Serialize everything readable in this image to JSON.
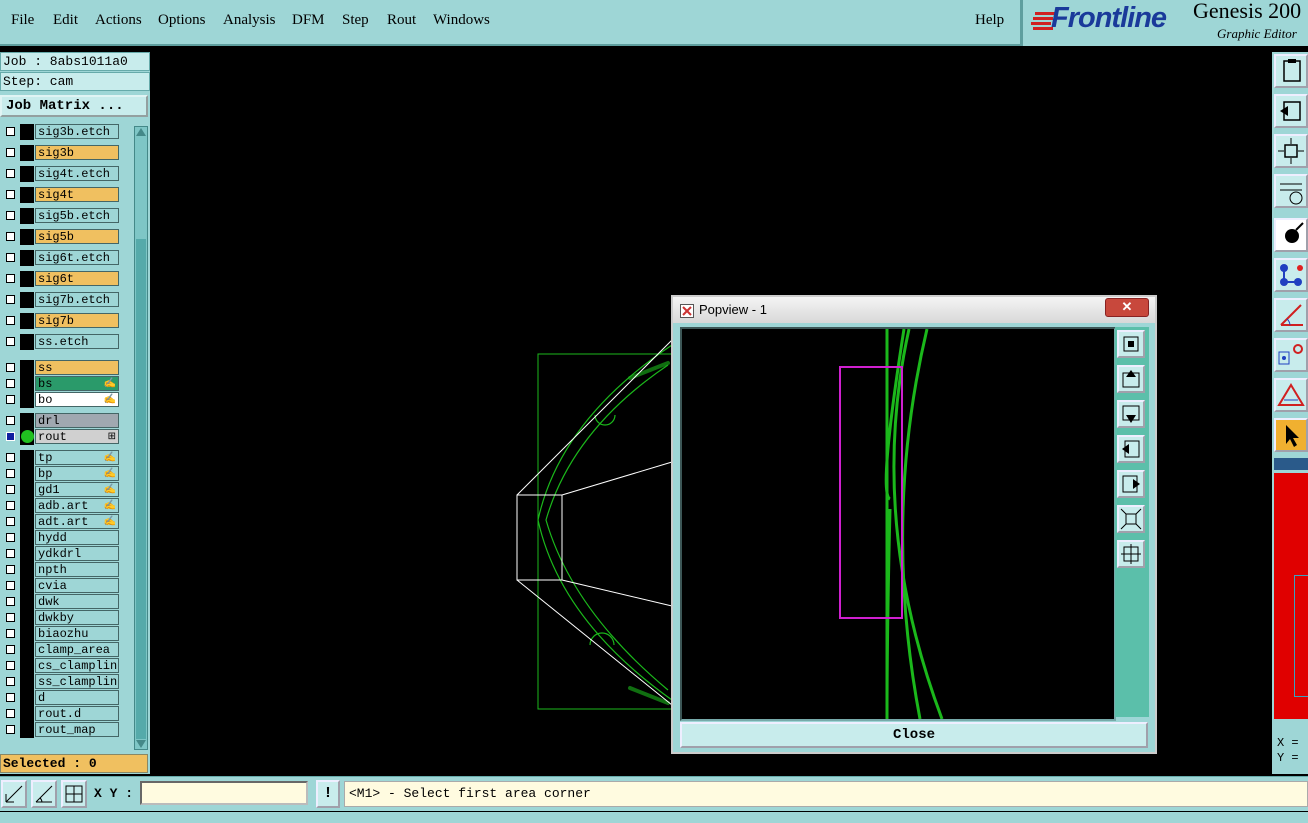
{
  "menubar": {
    "items": [
      "File",
      "Edit",
      "Actions",
      "Options",
      "Analysis",
      "DFM",
      "Step",
      "Rout",
      "Windows"
    ],
    "help": "Help"
  },
  "brand": {
    "logo": "Frontline",
    "title": "Genesis 200",
    "subtitle": "Graphic Editor"
  },
  "job": {
    "job_line": "Job : 8abs1011a0",
    "step_line": "Step: cam",
    "matrix_button": "Job Matrix ...",
    "selected": "Selected : 0"
  },
  "layers": [
    {
      "name": "sig3b.etch",
      "color": "#9ed6d6",
      "mark": ""
    },
    {
      "name": "sig3b",
      "color": "#f0c060",
      "mark": ""
    },
    {
      "name": "sig4t.etch",
      "color": "#9ed6d6",
      "mark": ""
    },
    {
      "name": "sig4t",
      "color": "#f0c060",
      "mark": ""
    },
    {
      "name": "sig5b.etch",
      "color": "#9ed6d6",
      "mark": ""
    },
    {
      "name": "sig5b",
      "color": "#f0c060",
      "mark": ""
    },
    {
      "name": "sig6t.etch",
      "color": "#9ed6d6",
      "mark": ""
    },
    {
      "name": "sig6t",
      "color": "#f0c060",
      "mark": ""
    },
    {
      "name": "sig7b.etch",
      "color": "#9ed6d6",
      "mark": ""
    },
    {
      "name": "sig7b",
      "color": "#f0c060",
      "mark": ""
    },
    {
      "name": "ss.etch",
      "color": "#9ed6d6",
      "mark": ""
    },
    {
      "name": "ss",
      "color": "#f0c060",
      "mark": ""
    },
    {
      "name": "bs",
      "color": "#2a9a6a",
      "mark": "✍"
    },
    {
      "name": "bo",
      "color": "#ffffff",
      "mark": "✍"
    },
    {
      "name": "drl",
      "color": "#a0a8b0",
      "mark": ""
    },
    {
      "name": "rout",
      "color": "#d0d0d0",
      "mark": "⊞",
      "active": true
    },
    {
      "name": "tp",
      "color": "#9ed6d6",
      "mark": "✍"
    },
    {
      "name": "bp",
      "color": "#9ed6d6",
      "mark": "✍"
    },
    {
      "name": "gd1",
      "color": "#9ed6d6",
      "mark": "✍"
    },
    {
      "name": "adb.art",
      "color": "#9ed6d6",
      "mark": "✍"
    },
    {
      "name": "adt.art",
      "color": "#9ed6d6",
      "mark": "✍"
    },
    {
      "name": "hydd",
      "color": "#9ed6d6",
      "mark": ""
    },
    {
      "name": "ydkdrl",
      "color": "#9ed6d6",
      "mark": ""
    },
    {
      "name": "npth",
      "color": "#9ed6d6",
      "mark": ""
    },
    {
      "name": "cvia",
      "color": "#9ed6d6",
      "mark": ""
    },
    {
      "name": "dwk",
      "color": "#9ed6d6",
      "mark": ""
    },
    {
      "name": "dwkby",
      "color": "#9ed6d6",
      "mark": ""
    },
    {
      "name": "biaozhu",
      "color": "#9ed6d6",
      "mark": ""
    },
    {
      "name": "clamp_area",
      "color": "#9ed6d6",
      "mark": ""
    },
    {
      "name": "cs_clampline",
      "color": "#9ed6d6",
      "mark": ""
    },
    {
      "name": "ss_clampline",
      "color": "#9ed6d6",
      "mark": ""
    },
    {
      "name": "d",
      "color": "#9ed6d6",
      "mark": ""
    },
    {
      "name": "rout.d",
      "color": "#9ed6d6",
      "mark": ""
    },
    {
      "name": "rout_map",
      "color": "#9ed6d6",
      "mark": ""
    }
  ],
  "popview": {
    "title": "Popview - 1",
    "close_x": "✕",
    "close_button": "Close"
  },
  "readout": {
    "x": "X =",
    "y": "Y ="
  },
  "bottom": {
    "xy_label": "X Y :",
    "xy_value": "",
    "bang": "!",
    "prompt": "<M1> - Select first area corner"
  }
}
